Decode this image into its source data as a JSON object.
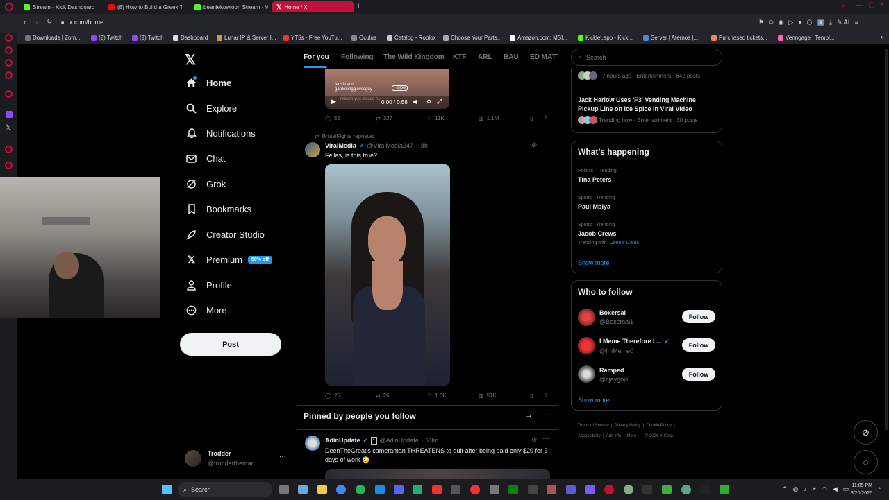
{
  "browser": {
    "tabs": [
      {
        "label": "Stream - Kick Dashboard",
        "color": "#53fc18"
      },
      {
        "label": "(8) How to Build a Greek T",
        "color": "#ff0000"
      },
      {
        "label": "beaniekowloon Stream - V",
        "color": "#53fc18"
      },
      {
        "label": "Home / X",
        "color": "#ffffff"
      }
    ],
    "url": "x.com/home",
    "bookmarks": [
      {
        "label": "Downloads | Zom..."
      },
      {
        "label": "(2) Twitch"
      },
      {
        "label": "(9) Twitch"
      },
      {
        "label": "Dashboard"
      },
      {
        "label": "Lunar IP & Server I..."
      },
      {
        "label": "YT5s - Free YouTu..."
      },
      {
        "label": "Oculus"
      },
      {
        "label": "Catalog - Roblox"
      },
      {
        "label": "Choose Your Parts..."
      },
      {
        "label": "Amazon.com: MSI..."
      },
      {
        "label": "Kicklet.app - Kick..."
      },
      {
        "label": "Server | Aternos |..."
      },
      {
        "label": "Purchased tickets..."
      },
      {
        "label": "Venngage | Templ..."
      }
    ],
    "ai_label": "AI"
  },
  "nav": {
    "items": [
      {
        "label": "Home",
        "icon": "home-icon"
      },
      {
        "label": "Explore",
        "icon": "search-icon"
      },
      {
        "label": "Notifications",
        "icon": "bell-icon"
      },
      {
        "label": "Chat",
        "icon": "mail-icon"
      },
      {
        "label": "Grok",
        "icon": "grok-icon"
      },
      {
        "label": "Bookmarks",
        "icon": "bookmark-icon"
      },
      {
        "label": "Creator Studio",
        "icon": "rocket-icon"
      },
      {
        "label": "Premium",
        "icon": "x-icon"
      },
      {
        "label": "Profile",
        "icon": "person-icon"
      },
      {
        "label": "More",
        "icon": "more-circle-icon"
      }
    ],
    "premium_badge": "50% off",
    "post_label": "Post",
    "account": {
      "name": "Trodder",
      "handle": "@troddertheman"
    }
  },
  "timeline": {
    "tabs": [
      "For you",
      "Following",
      "The Wild Kingdom",
      "KTF",
      "ARL",
      "BAU",
      "ED MATT"
    ],
    "video_tweet": {
      "overlay_user": "fensfit and gardeningglovesguy",
      "overlay_follow": "Follow",
      "overlay_caption": "reason you should n...",
      "time": "0:00 / 0:58",
      "replies": "55",
      "reposts": "327",
      "likes": "11K",
      "views": "1.1M"
    },
    "tweet": {
      "reposted_by": "BrutalFights reposted",
      "name": "ViralMedia",
      "handle": "@ViralMedia247",
      "time": "8h",
      "text": "Fellas, is this true?",
      "replies": "25",
      "reposts": "26",
      "likes": "1.3K",
      "views": "51K"
    },
    "pinned_header": "Pinned by people you follow",
    "pinned_tweet": {
      "name": "AdinUpdate",
      "handle": "@AdinUpdate",
      "time": "23m",
      "text": "DeenTheGreat's cameraman THREATENS to quit after being paid only $20 for 3 days of work 😳"
    }
  },
  "right": {
    "search_placeholder": "Search",
    "news": [
      {
        "meta": "7 hours ago · Entertainment · 642 posts"
      },
      {
        "title": "Jack Harlow Uses 'F3' Vending Machine Pickup Line on Ice Spice in Viral Video",
        "meta": "Trending now · Entertainment · 30 posts"
      }
    ],
    "happening": {
      "title": "What’s happening",
      "trends": [
        {
          "meta": "Politics · Trending",
          "name": "Tina Peters"
        },
        {
          "meta": "Sports · Trending",
          "name": "Paul Mbiya"
        },
        {
          "meta": "Sports · Trending",
          "name": "Jacob Crews",
          "with_label": "Trending with",
          "with_name": "Dennis Gates"
        }
      ],
      "show_more": "Show more"
    },
    "who_to_follow": {
      "title": "Who to follow",
      "users": [
        {
          "name": "Boxersal",
          "handle": "@Boxersal1",
          "button": "Follow"
        },
        {
          "name": "I Meme Therefore I ...",
          "handle": "@ImMeme0",
          "button": "Follow"
        },
        {
          "name": "Ramped",
          "handle": "@cjaygojii",
          "button": "Follow"
        }
      ],
      "show_more": "Show more"
    },
    "footer": [
      "Terms of Service",
      "Privacy Policy",
      "Cookie Policy",
      "Accessibility",
      "Ads info",
      "More ···",
      "© 2026 X Corp."
    ]
  },
  "taskbar": {
    "search_label": "Search",
    "time": "11:05 PM",
    "date": "3/20/2026"
  }
}
